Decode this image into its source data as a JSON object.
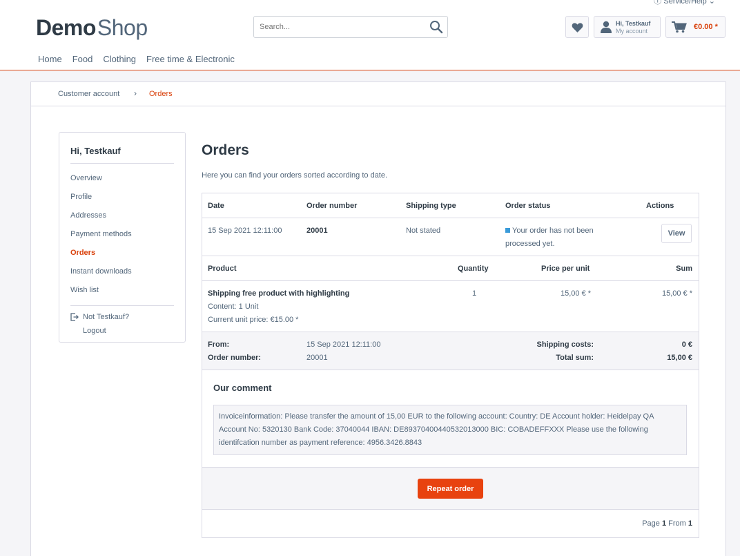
{
  "header": {
    "service_help": "Service/Help",
    "logo_demo": "Demo",
    "logo_shop": "Shop",
    "search_placeholder": "Search...",
    "account_greeting": "Hi, Testkauf",
    "account_sub": "My account",
    "cart_amount": "€0.00 *"
  },
  "nav": [
    "Home",
    "Food",
    "Clothing",
    "Free time & Electronic"
  ],
  "breadcrumb": [
    "Customer account",
    "Orders"
  ],
  "sidebar": {
    "greeting": "Hi, Testkauf",
    "items": [
      "Overview",
      "Profile",
      "Addresses",
      "Payment methods",
      "Orders",
      "Instant downloads",
      "Wish list"
    ],
    "not_user": "Not Testkauf?",
    "logout": "Logout"
  },
  "page": {
    "title": "Orders",
    "intro": "Here you can find your orders sorted according to date."
  },
  "orders_table": {
    "headers": [
      "Date",
      "Order number",
      "Shipping type",
      "Order status",
      "Actions"
    ],
    "rows": [
      {
        "date": "15 Sep 2021 12:11:00",
        "order_number": "20001",
        "shipping_type": "Not stated",
        "status_line1": "Your order has not been",
        "status_line2": "processed yet.",
        "action": "View"
      }
    ]
  },
  "details": {
    "headers": [
      "Product",
      "Quantity",
      "Price per unit",
      "Sum"
    ],
    "items": [
      {
        "name": "Shipping free product with highlighting",
        "content": "Content: 1 Unit",
        "unit_price": "Current unit price: €15.00 *",
        "quantity": "1",
        "price": "15,00 € *",
        "sum": "15,00 € *"
      }
    ],
    "summary": {
      "from_label": "From:",
      "from_value": "15 Sep 2021 12:11:00",
      "order_label": "Order number:",
      "order_value": "20001",
      "shipping_label": "Shipping costs:",
      "shipping_value": "0 €",
      "total_label": "Total sum:",
      "total_value": "15,00 €"
    },
    "comment_title": "Our comment",
    "comment_text": "Invoiceinformation: Please transfer the amount of 15,00 EUR to the following account: Country: DE Account holder: Heidelpay QA Account No: 5320130 Bank Code: 37040044 IBAN: DE89370400440532013000 BIC: COBADEFFXXX Please use the following identifcation number as payment reference: 4956.3426.8843",
    "repeat_button": "Repeat order"
  },
  "pagination": {
    "page_label": "Page",
    "current": "1",
    "from_label": "From",
    "total": "1"
  },
  "colors": {
    "accent": "#d9400b",
    "button": "#e8420f",
    "text": "#52667a",
    "heading": "#2f3b46",
    "border": "#dadae5",
    "status_dot": "#3a9bd9"
  }
}
